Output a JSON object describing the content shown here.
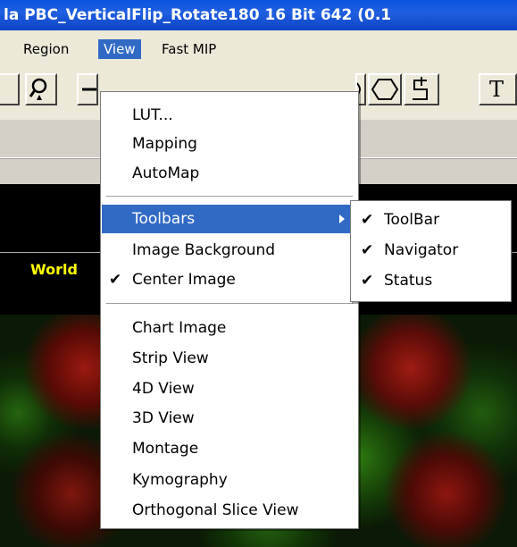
{
  "window": {
    "title": "la PBC_VerticalFlip_Rotate180 16 Bit 642 (0.1"
  },
  "menubar": {
    "items": [
      "Region",
      "View",
      "Fast MIP"
    ],
    "active": "View"
  },
  "toolbar": {
    "text_tool_label": "T"
  },
  "image": {
    "overlay_text": "World"
  },
  "view_menu": {
    "group1": [
      "LUT...",
      "Mapping",
      "AutoMap"
    ],
    "group2": [
      {
        "label": "Toolbars",
        "submenu": true,
        "highlighted": true
      },
      {
        "label": "Image Background",
        "checked": false
      },
      {
        "label": "Center Image",
        "checked": true
      }
    ],
    "group3": [
      "Chart Image",
      "Strip View",
      "4D View",
      "3D View",
      "Montage",
      "Kymography",
      "Orthogonal Slice View"
    ]
  },
  "toolbars_submenu": {
    "items": [
      {
        "label": "ToolBar",
        "checked": true
      },
      {
        "label": "Navigator",
        "checked": true
      },
      {
        "label": "Status",
        "checked": true
      }
    ]
  },
  "check_glyph": "✔",
  "colors": {
    "highlight": "#316ac5",
    "titlebar": "#0a53e0",
    "overlay_text": "#ffff00"
  }
}
